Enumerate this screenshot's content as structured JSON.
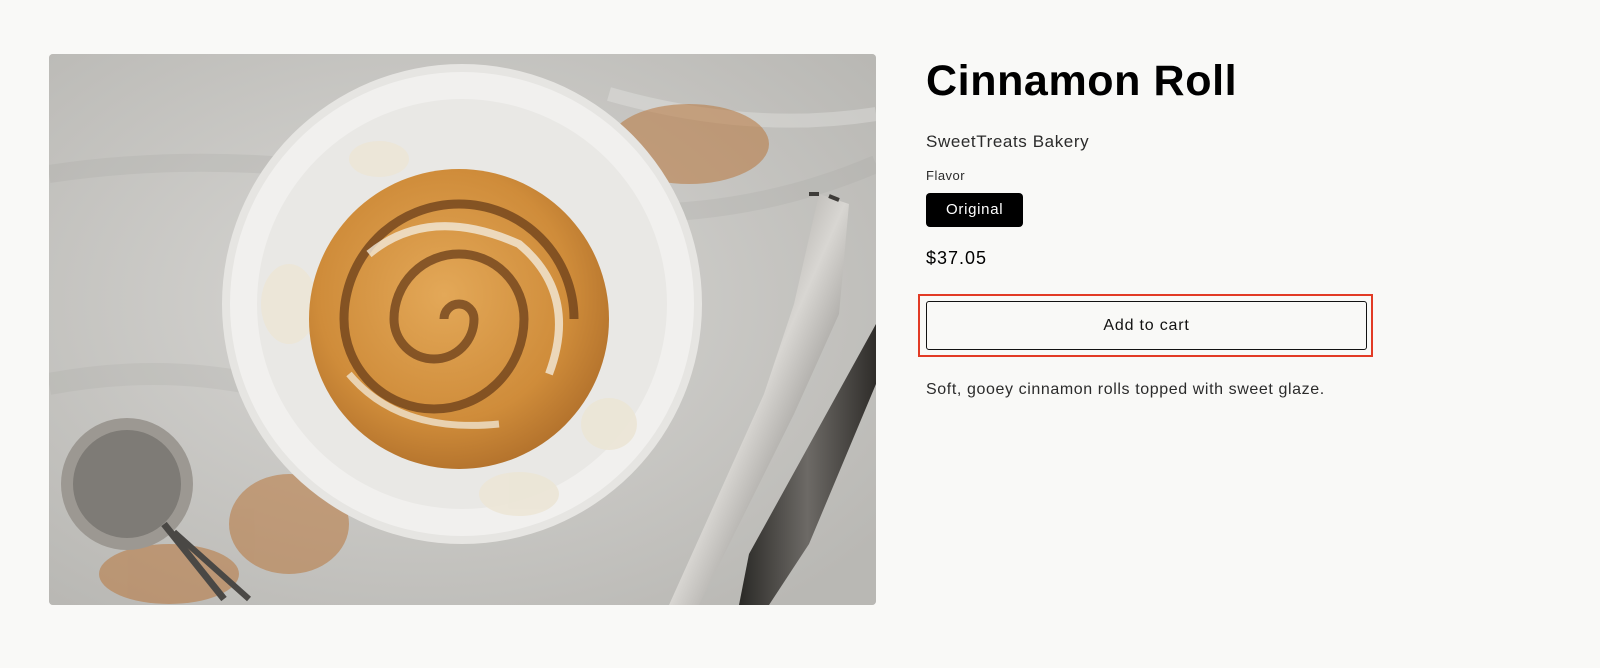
{
  "product": {
    "title": "Cinnamon Roll",
    "vendor": "SweetTreats Bakery",
    "option_label": "Flavor",
    "selected_option": "Original",
    "price": "$37.05",
    "add_to_cart_label": "Add to cart",
    "description": "Soft, gooey cinnamon rolls topped with sweet glaze.",
    "image": {
      "icon": "product-photo-cinnamon-roll",
      "background_color": "#c9c8c5",
      "pastry_color": "#d89a45"
    }
  },
  "highlight": {
    "target": "add-to-cart-button",
    "color": "#e23b25"
  }
}
